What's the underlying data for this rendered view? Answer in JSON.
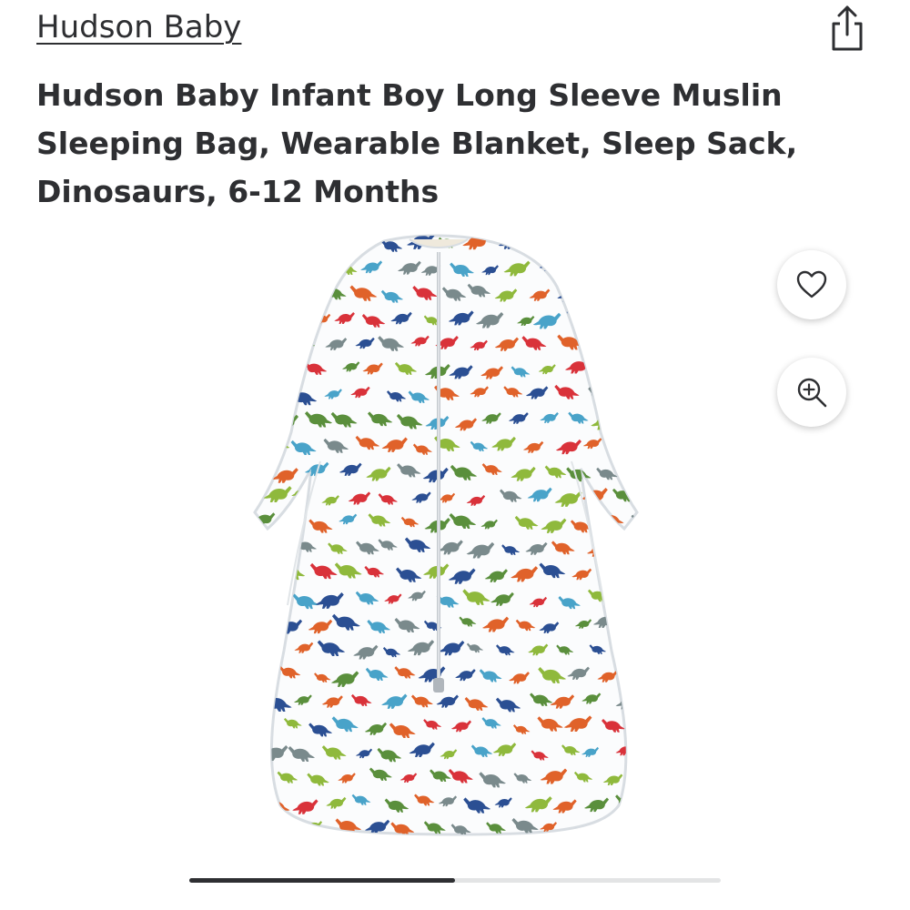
{
  "product": {
    "brand": "Hudson Baby",
    "title": "Hudson Baby Infant Boy Long Sleeve Muslin Sleeping Bag, Wearable Blanket, Sleep Sack, Dinosaurs, 6-12 Months"
  },
  "icons": {
    "share": "share-icon",
    "favorite": "heart-icon",
    "zoom": "zoom-in-icon"
  },
  "carousel": {
    "progress": 0.5
  },
  "colors": {
    "text": "#2e2f32",
    "dino_palette": [
      "#e0622a",
      "#2b4f93",
      "#5a8f3c",
      "#d9323a",
      "#49a3c9",
      "#8fb93c",
      "#7a8a8c"
    ]
  }
}
